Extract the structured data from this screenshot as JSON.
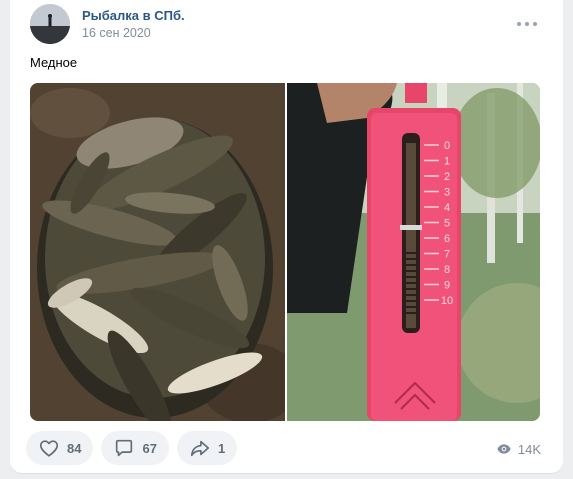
{
  "post": {
    "author": "Рыбалка в СПб.",
    "date": "16 сен 2020",
    "text": "Медное"
  },
  "scale": {
    "marks": [
      "0",
      "1",
      "2",
      "3",
      "4",
      "5",
      "6",
      "7",
      "8",
      "9",
      "10"
    ]
  },
  "actions": {
    "likes": "84",
    "comments": "67",
    "shares": "1"
  },
  "views": "14K",
  "colors": {
    "link": "#2a5885",
    "muted": "#818c99",
    "pill_bg": "#f0f2f5",
    "scale_pink": "#e8456a"
  },
  "icons": [
    "avatar",
    "more-icon",
    "heart-icon",
    "comment-icon",
    "share-icon",
    "eye-icon"
  ]
}
